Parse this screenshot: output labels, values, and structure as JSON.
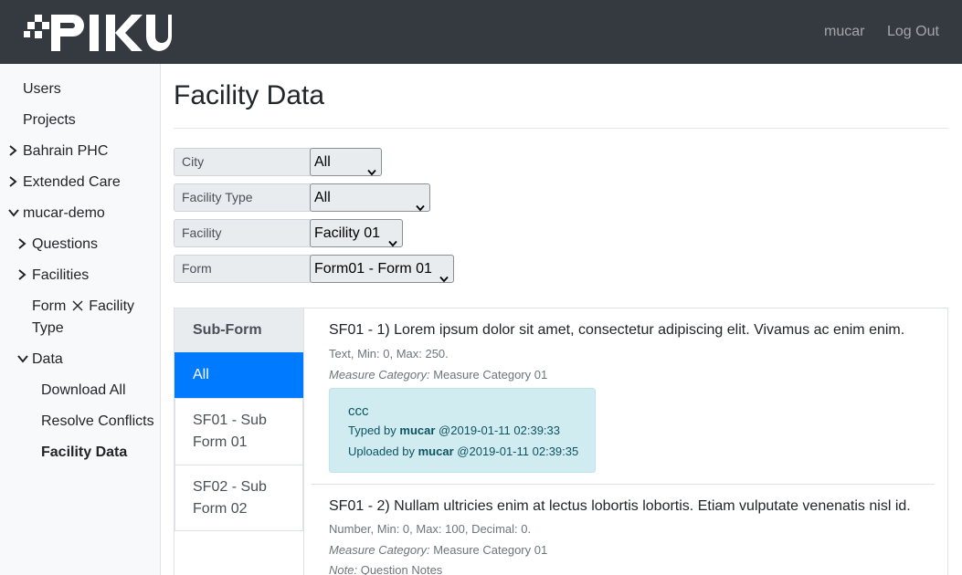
{
  "navbar": {
    "brand": "PIKU",
    "user": "mucar",
    "logout": "Log Out"
  },
  "sidebar": {
    "users": "Users",
    "projects": "Projects",
    "bahrain": "Bahrain PHC",
    "extended": "Extended Care",
    "demo": "mucar-demo",
    "questions": "Questions",
    "facilities": "Facilities",
    "form_facility_a": "Form",
    "form_facility_b": "Facility",
    "form_facility_c": "Type",
    "data": "Data",
    "download": "Download All",
    "resolve": "Resolve Conflicts",
    "facility_data": "Facility Data"
  },
  "page": {
    "title": "Facility Data"
  },
  "filters": {
    "city_label": "City",
    "city_value": "All",
    "type_label": "Facility Type",
    "type_value": "All",
    "facility_label": "Facility",
    "facility_value": "Facility 01",
    "form_label": "Form",
    "form_value": "Form01 - Form 01"
  },
  "subform": {
    "header": "Sub-Form",
    "tab_all": "All",
    "tab1_a": "SF01 - Sub",
    "tab1_b": "Form 01",
    "tab2_a": "SF02 - Sub",
    "tab2_b": "Form 02"
  },
  "questions": [
    {
      "title": "SF01 - 1) Lorem ipsum dolor sit amet, consectetur adipiscing elit. Vivamus ac enim enim.",
      "meta": "Text, Min: 0, Max: 250.",
      "category_label": "Measure Category:",
      "category": "Measure Category 01",
      "answer": "ccc",
      "typed_by_label": "Typed by",
      "typed_by": "mucar",
      "typed_at": "@2019-01-11 02:39:33",
      "uploaded_by_label": "Uploaded by",
      "uploaded_by": "mucar",
      "uploaded_at": "@2019-01-11 02:39:35"
    },
    {
      "title": "SF01 - 2) Nullam ultricies enim at lectus lobortis lobortis. Etiam vulputate venenatis nisl id.",
      "meta": "Number, Min: 0, Max: 100, Decimal: 0.",
      "category_label": "Measure Category:",
      "category": "Measure Category 01",
      "note_label": "Note:",
      "note": "Question Notes"
    }
  ],
  "colors": {
    "navbar": "#343a40",
    "active_tab": "#007bff",
    "answer_bg": "#d1ecf1",
    "answer_text": "#0c5460"
  },
  "icons": {
    "caret_right": "chevron-right-icon",
    "caret_down": "chevron-down-icon",
    "times": "times-icon"
  }
}
